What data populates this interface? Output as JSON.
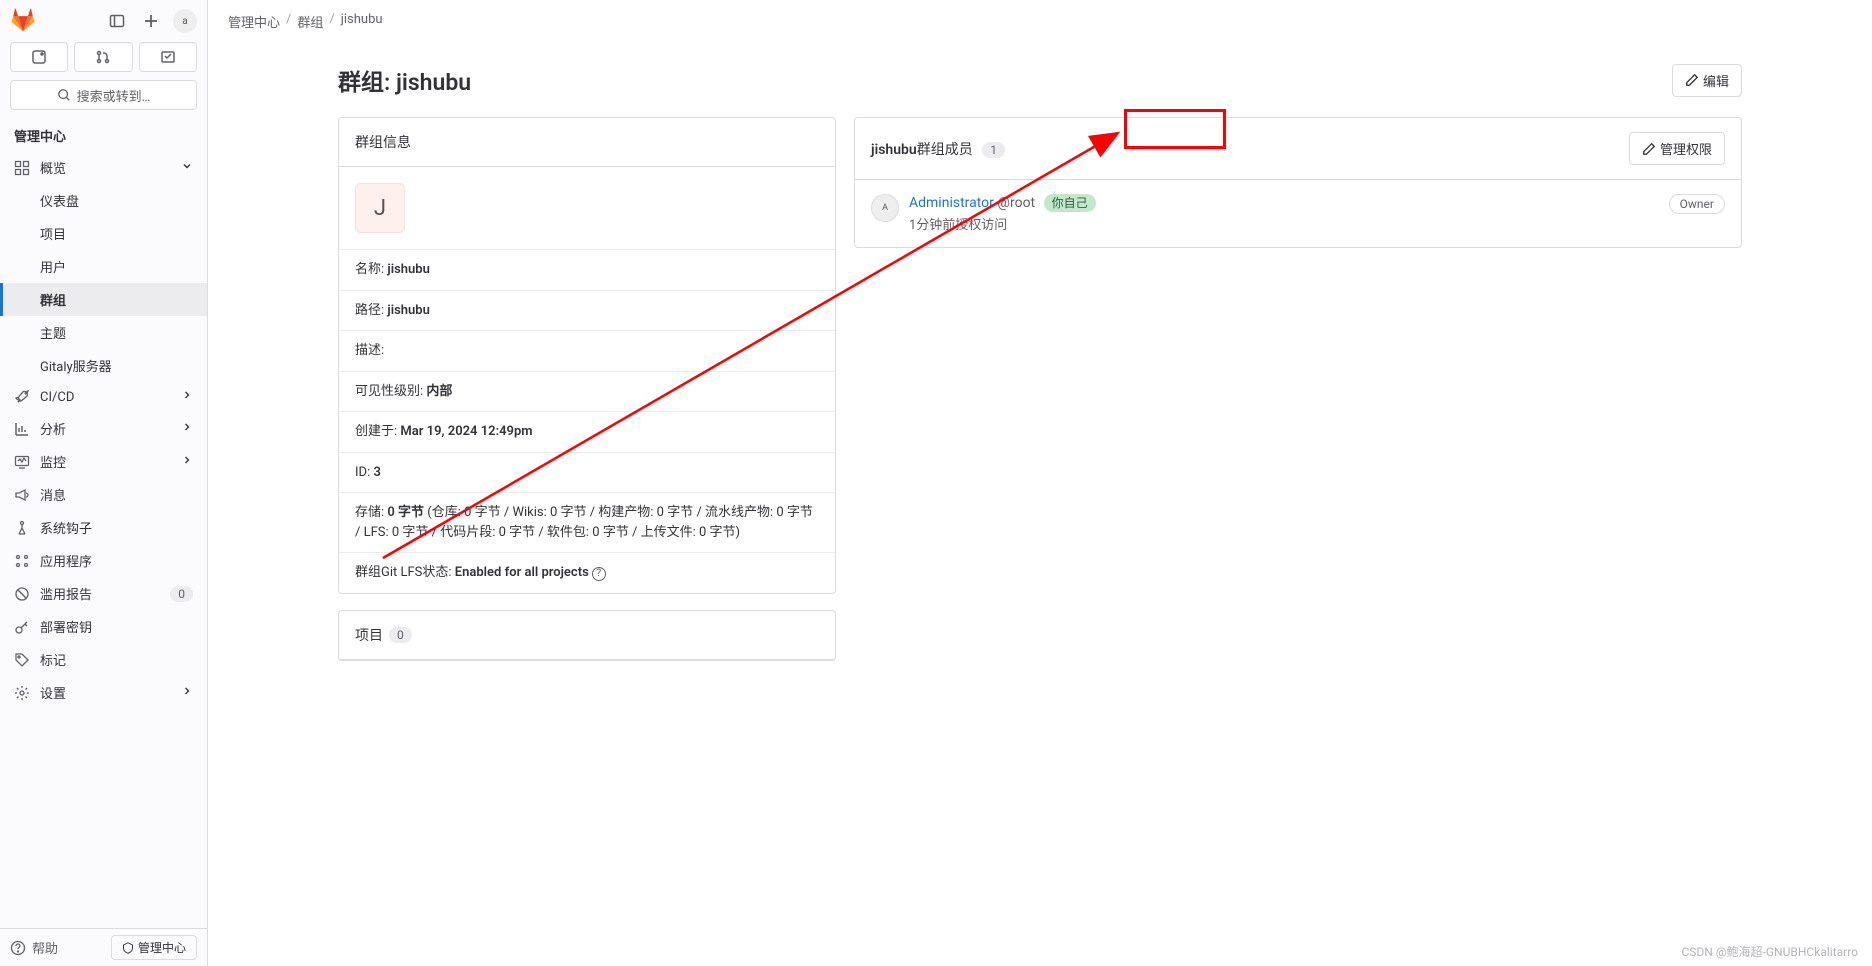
{
  "topbar": {
    "avatar_text": "a"
  },
  "search": {
    "placeholder": "搜索或转到…"
  },
  "sidebar": {
    "section_title": "管理中心",
    "overview": {
      "label": "概览"
    },
    "items": [
      {
        "label": "仪表盘"
      },
      {
        "label": "项目"
      },
      {
        "label": "用户"
      },
      {
        "label": "群组"
      },
      {
        "label": "主题"
      },
      {
        "label": "Gitaly服务器"
      }
    ],
    "cicd": {
      "label": "CI/CD"
    },
    "analytics": {
      "label": "分析"
    },
    "monitor": {
      "label": "监控"
    },
    "messages": {
      "label": "消息"
    },
    "hooks": {
      "label": "系统钩子"
    },
    "apps": {
      "label": "应用程序"
    },
    "abuse": {
      "label": "滥用报告",
      "count": "0"
    },
    "deploy": {
      "label": "部署密钥"
    },
    "labels": {
      "label": "标记"
    },
    "settings": {
      "label": "设置"
    },
    "help": "帮助",
    "admin_btn": "管理中心"
  },
  "breadcrumb": {
    "a": "管理中心",
    "b": "群组",
    "c": "jishubu"
  },
  "page": {
    "title": "群组: jishubu",
    "edit_btn": "编辑"
  },
  "info_card": {
    "title": "群组信息",
    "avatar_letter": "J",
    "name_label": "名称: ",
    "name_value": "jishubu",
    "path_label": "路径: ",
    "path_value": "jishubu",
    "desc_label": "描述:",
    "visibility_label": "可见性级别: ",
    "visibility_value": "内部",
    "created_label": "创建于:  ",
    "created_value": "Mar 19, 2024 12:49pm",
    "id_label": "ID: ",
    "id_value": "3",
    "storage_label": "存储: ",
    "storage_value": "0 字节",
    "storage_detail": " (仓库: 0 字节 / Wikis: 0 字节 / 构建产物: 0 字节 / 流水线产物:  0 字节 / LFS: 0 字节 / 代码片段: 0 字节 / 软件包: 0 字节 / 上传文件: 0 字节)",
    "lfs_label": "群组Git LFS状态:  ",
    "lfs_value": "Enabled for all projects"
  },
  "projects_card": {
    "title": "项目",
    "count": "0"
  },
  "members_card": {
    "group_name": "jishubu",
    "title_suffix": "群组成员",
    "count": "1",
    "manage_btn": "管理权限",
    "member": {
      "avatar_text": "A",
      "name": "Administrator",
      "handle": "@root",
      "self_badge": "你自己",
      "sub": "1分钟前授权访问",
      "role": "Owner"
    }
  },
  "watermark": "CSDN @鲍海超-GNUBHCkalitarro"
}
